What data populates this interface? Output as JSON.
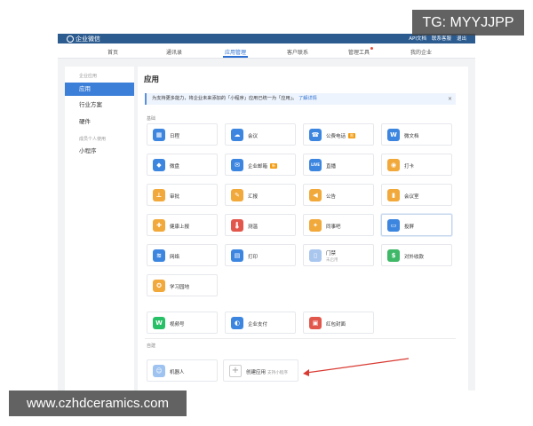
{
  "topbar": {
    "logo": "企业微信",
    "links": [
      "API文档",
      "联系客服",
      "退出"
    ]
  },
  "nav": {
    "items": [
      {
        "label": "首页",
        "active": false,
        "dot": false
      },
      {
        "label": "通讯录",
        "active": false,
        "dot": false
      },
      {
        "label": "应用管理",
        "active": true,
        "dot": false
      },
      {
        "label": "客户联系",
        "active": false,
        "dot": false
      },
      {
        "label": "管理工具",
        "active": false,
        "dot": true
      },
      {
        "label": "我的企业",
        "active": false,
        "dot": false
      }
    ]
  },
  "sidebar": {
    "cat1": "企业应用",
    "items": [
      {
        "label": "应用",
        "active": true
      },
      {
        "label": "行业方案",
        "active": false
      },
      {
        "label": "硬件",
        "active": false
      }
    ],
    "cat2": "成员个人使用",
    "item_mini": "小程序"
  },
  "main": {
    "title": "应用",
    "notice_text": "为支持更多能力，将企业未来添加的「小程序」应用已统一为「应用」。",
    "notice_link": "了解详情",
    "notice_close": "×",
    "section_basic": "基础",
    "section_custom": "自建"
  },
  "apps": [
    {
      "name": "日程",
      "icon": "calendar-icon",
      "glyph": "▦",
      "color": "#3d86e0",
      "badge": ""
    },
    {
      "name": "会议",
      "icon": "cloud-meeting-icon",
      "glyph": "☁",
      "color": "#3d86e0",
      "badge": ""
    },
    {
      "name": "公费电话",
      "icon": "phone-icon",
      "glyph": "☎",
      "color": "#3d86e0",
      "badge": "限"
    },
    {
      "name": "微文档",
      "icon": "doc-w-icon",
      "glyph": "W",
      "color": "#3d86e0",
      "badge": ""
    },
    {
      "name": "微盘",
      "icon": "disk-icon",
      "glyph": "◆",
      "color": "#3d86e0",
      "badge": ""
    },
    {
      "name": "企业邮箱",
      "icon": "mail-icon",
      "glyph": "✉",
      "color": "#3d86e0",
      "badge": "新"
    },
    {
      "name": "直播",
      "icon": "live-icon",
      "glyph": "LIVE",
      "color": "#3d86e0",
      "badge": ""
    },
    {
      "name": "打卡",
      "icon": "location-pin-icon",
      "glyph": "◉",
      "color": "#f2a93b",
      "badge": ""
    },
    {
      "name": "审批",
      "icon": "stamp-icon",
      "glyph": "⊥",
      "color": "#f2a93b",
      "badge": ""
    },
    {
      "name": "汇报",
      "icon": "report-icon",
      "glyph": "✎",
      "color": "#f2a93b",
      "badge": ""
    },
    {
      "name": "公告",
      "icon": "megaphone-icon",
      "glyph": "◀",
      "color": "#f2a93b",
      "badge": ""
    },
    {
      "name": "会议室",
      "icon": "door-icon",
      "glyph": "▮",
      "color": "#f2a93b",
      "badge": ""
    },
    {
      "name": "健康上报",
      "icon": "health-report-icon",
      "glyph": "✚",
      "color": "#f2a93b",
      "badge": ""
    },
    {
      "name": "测温",
      "icon": "thermometer-icon",
      "glyph": "🌡",
      "color": "#e2574c",
      "badge": ""
    },
    {
      "name": "同事吧",
      "icon": "colleague-icon",
      "glyph": "✦",
      "color": "#f2a93b",
      "badge": ""
    },
    {
      "name": "投屏",
      "icon": "screen-cast-icon",
      "glyph": "▭",
      "color": "#3d86e0",
      "badge": ""
    },
    {
      "name": "网络",
      "icon": "wifi-icon",
      "glyph": "≋",
      "color": "#3d86e0",
      "badge": ""
    },
    {
      "name": "打印",
      "icon": "printer-icon",
      "glyph": "▤",
      "color": "#3d86e0",
      "badge": ""
    },
    {
      "name": "门禁",
      "icon": "access-control-icon",
      "glyph": "▯",
      "color": "#a9c6ee",
      "badge": "",
      "sub": "未启用"
    },
    {
      "name": "对外收款",
      "icon": "payment-icon",
      "glyph": "$",
      "color": "#3fb868",
      "badge": ""
    },
    {
      "name": "学习园地",
      "icon": "study-icon",
      "glyph": "✪",
      "color": "#f2a93b",
      "badge": ""
    }
  ],
  "apps2": [
    {
      "name": "视频号",
      "icon": "channels-icon",
      "glyph": "W",
      "color": "#27c067"
    },
    {
      "name": "企业支付",
      "icon": "enterprise-pay-icon",
      "glyph": "◐",
      "color": "#3d86e0"
    },
    {
      "name": "红包封面",
      "icon": "red-envelope-icon",
      "glyph": "▣",
      "color": "#e2574c"
    }
  ],
  "custom": {
    "robot": {
      "name": "机器人",
      "icon": "robot-icon",
      "glyph": "☺",
      "color": "#9fc3f0"
    },
    "create_label": "创建应用",
    "create_hint": "支持小程序"
  },
  "overlays": {
    "tg": "TG: MYYJJPP",
    "url": "www.czhdceramics.com"
  }
}
